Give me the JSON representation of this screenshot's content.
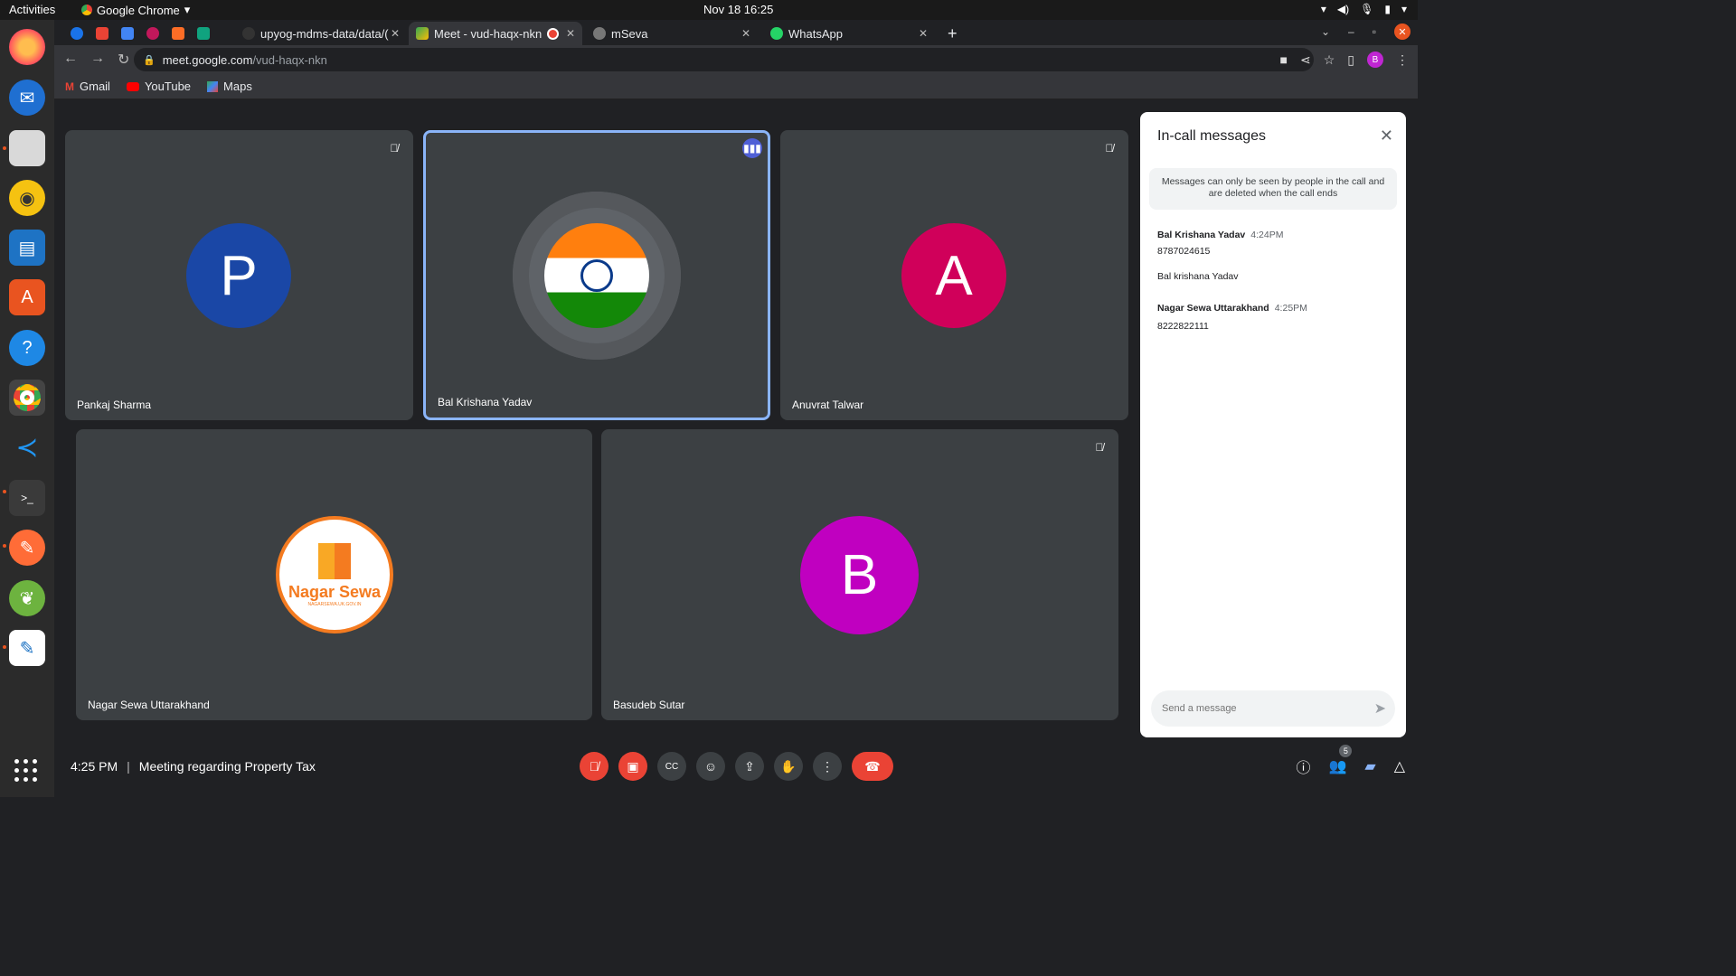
{
  "system": {
    "activities": "Activities",
    "app_name": "Google Chrome",
    "datetime": "Nov 18  16:25"
  },
  "tabs": [
    {
      "label": "upyog-mdms-data/data/("
    },
    {
      "label": "Meet - vud-haqx-nkn"
    },
    {
      "label": "mSeva"
    },
    {
      "label": "WhatsApp"
    }
  ],
  "omnibox": {
    "host": "meet.google.com",
    "path": "/vud-haqx-nkn"
  },
  "profile_initial": "B",
  "bookmarks": [
    {
      "label": "Gmail"
    },
    {
      "label": "YouTube"
    },
    {
      "label": "Maps"
    }
  ],
  "participants": [
    {
      "name": "Pankaj Sharma",
      "initial": "P",
      "color": "#1a47a6"
    },
    {
      "name": "Bal Krishana Yadav",
      "initial": "",
      "color": "#5f6368"
    },
    {
      "name": "Anuvrat Talwar",
      "initial": "A",
      "color": "#d0005a"
    },
    {
      "name": "Nagar Sewa Uttarakhand",
      "logo_text": "Nagar Sewa",
      "logo_sub": "NAGARSEWA.UK.GOV.IN",
      "color": "#f47b20"
    },
    {
      "name": "Basudeb Sutar",
      "initial": "B",
      "color": "#c000c0"
    }
  ],
  "chat": {
    "title": "In-call messages",
    "notice": "Messages can only be seen by people in the call and are deleted when the call ends",
    "messages": [
      {
        "sender": "Bal Krishana Yadav",
        "time": "4:24PM",
        "lines": [
          "8787024615",
          "Bal krishana Yadav"
        ]
      },
      {
        "sender": "Nagar Sewa Uttarakhand",
        "time": "4:25PM",
        "lines": [
          "8222822111"
        ]
      }
    ],
    "placeholder": "Send a message"
  },
  "meeting": {
    "time": "4:25 PM",
    "title": "Meeting regarding Property Tax",
    "participant_count": "5"
  }
}
